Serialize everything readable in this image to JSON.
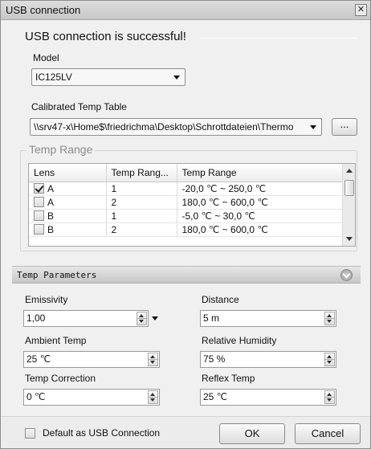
{
  "window": {
    "title": "USB connection",
    "close_glyph": "✕"
  },
  "status": {
    "message": "USB connection is successful!"
  },
  "model": {
    "label": "Model",
    "value": "IC125LV"
  },
  "calibrated": {
    "label": "Calibrated Temp Table",
    "value": "\\\\srv47-x\\Home$\\friedrichma\\Desktop\\Schrottdateien\\Thermo",
    "browse_label": "..."
  },
  "temp_range": {
    "group_title": "Temp Range",
    "columns": [
      "Lens",
      "Temp Rang...",
      "Temp Range"
    ],
    "rows": [
      {
        "checked": true,
        "lens": "A",
        "index": "1",
        "range": "-20,0 ℃ ~ 250,0 ℃"
      },
      {
        "checked": false,
        "lens": "A",
        "index": "2",
        "range": "180,0 ℃ ~ 600,0 ℃"
      },
      {
        "checked": false,
        "lens": "B",
        "index": "1",
        "range": "-5,0 ℃ ~ 30,0 ℃"
      },
      {
        "checked": false,
        "lens": "B",
        "index": "2",
        "range": "180,0 ℃ ~ 600,0 ℃"
      }
    ]
  },
  "params": {
    "header": "Temp Parameters",
    "emissivity": {
      "label": "Emissivity",
      "value": "1,00"
    },
    "distance": {
      "label": "Distance",
      "value": "5 m"
    },
    "ambient": {
      "label": "Ambient Temp",
      "value": "25 ℃"
    },
    "humidity": {
      "label": "Relative Humidity",
      "value": "75 %"
    },
    "correction": {
      "label": "Temp Correction",
      "value": "0 ℃"
    },
    "reflex": {
      "label": "Reflex Temp",
      "value": "25 ℃"
    }
  },
  "footer": {
    "default_label": "Default as USB Connection",
    "ok": "OK",
    "cancel": "Cancel"
  }
}
